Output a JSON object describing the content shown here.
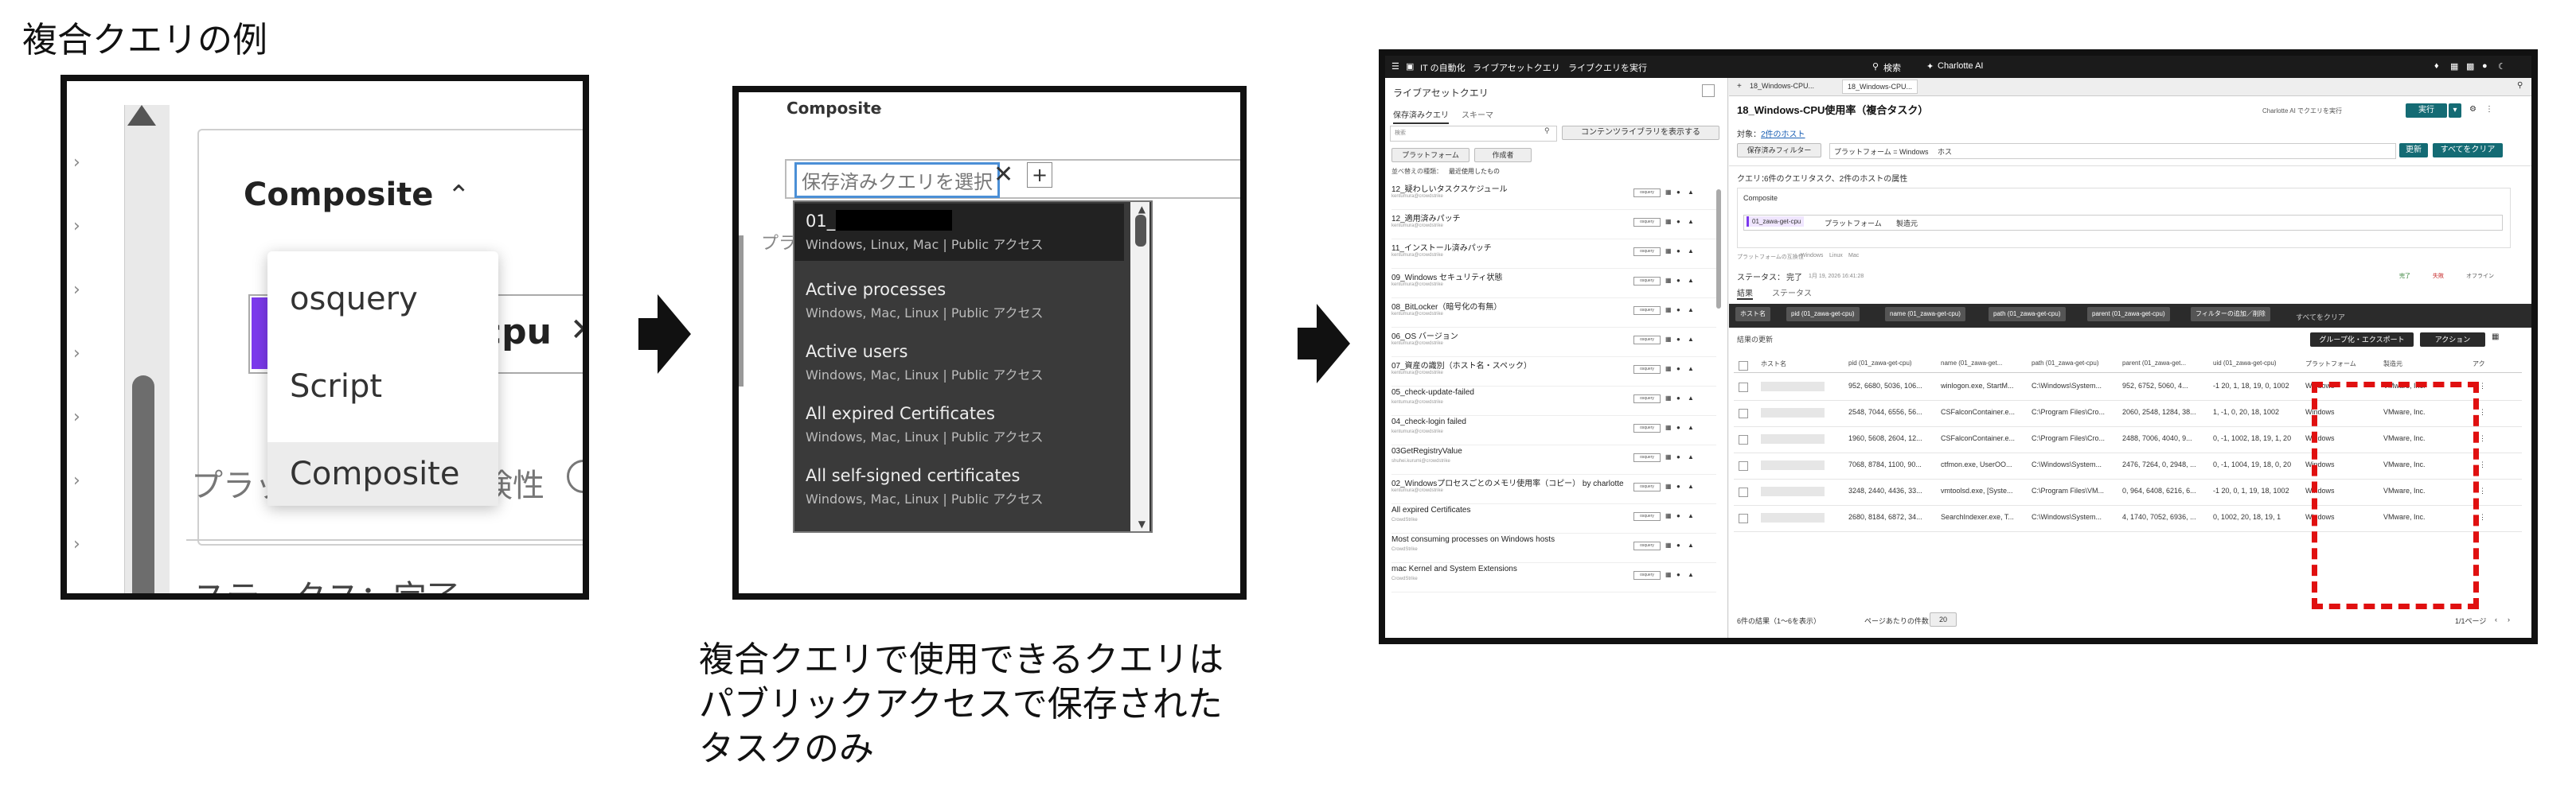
{
  "figure": {
    "title": "複合クエリの例",
    "caption_lines": [
      "複合クエリで使用できるクエリは",
      "パブリックアクセスで保存された",
      "タスクのみ"
    ]
  },
  "panel1": {
    "selector_label": "Composite",
    "menu_items": [
      "osquery",
      "Script",
      "Composite"
    ],
    "chip_text": "cpu",
    "platform_label": "プラッ",
    "search_label": "検性",
    "status_text": "ステータス：完了"
  },
  "panel2": {
    "selector_label": "Composite",
    "placeholder": "保存済みクエリを選択",
    "platform_label": "プラ",
    "items": [
      {
        "name": "01_",
        "sub": "Windows, Linux, Mac | Public アクセス"
      },
      {
        "name": "Active processes",
        "sub": "Windows, Mac, Linux | Public アクセス"
      },
      {
        "name": "Active users",
        "sub": "Windows, Mac, Linux | Public アクセス"
      },
      {
        "name": "All expired Certificates",
        "sub": "Windows, Mac, Linux | Public アクセス"
      },
      {
        "name": "All self-signed certificates",
        "sub": "Windows, Mac, Linux | Public アクセス"
      }
    ]
  },
  "panel3": {
    "topbar": {
      "menu": "IT の自動化",
      "crumb1": "ライブアセットクエリ",
      "crumb2": "ライブクエリを実行",
      "search": "検索",
      "brand": "Charlotte AI"
    },
    "left": {
      "title": "ライブアセットクエリ",
      "tabs": [
        "保存済みクエリ",
        "スキーマ"
      ],
      "search_placeholder": "検索",
      "content_library_btn": "コンテンツライブラリを表示する",
      "filters": [
        "プラットフォーム",
        "作成者"
      ],
      "sort_label": "並べ替えの種類：",
      "sort_value": "最近使用したもの",
      "rows": [
        {
          "name": "12_疑わしいタスクスケジュール",
          "author": "kentumura@crowdstrike"
        },
        {
          "name": "12_適用済みパッチ",
          "author": "kentumura@crowdstrike"
        },
        {
          "name": "11_インストール済みパッチ",
          "author": "kentumura@crowdstrike"
        },
        {
          "name": "09_Windows セキュリティ状態",
          "author": "kentumura@crowdstrike"
        },
        {
          "name": "08_BitLocker（暗号化の有無）",
          "author": "kentumura@crowdstrike"
        },
        {
          "name": "06_OS バージョン",
          "author": "kentumura@crowdstrike"
        },
        {
          "name": "07_資産の識別（ホスト名・スペック）",
          "author": "kentumura@crowdstrike"
        },
        {
          "name": "05_check-update-failed",
          "author": "kentumura@crowdstrike"
        },
        {
          "name": "04_check-login failed",
          "author": "kentumura@crowdstrike"
        },
        {
          "name": "03GetRegistryValue",
          "author": "shuhei.kurumi@crowdstrike"
        },
        {
          "name": "02_Windowsプロセスごとのメモリ使用率（コピー） by charlotte",
          "author": "kentumura@crowdstrike"
        },
        {
          "name": "All expired Certificates",
          "author": "CrowdStrike"
        },
        {
          "name": "Most consuming processes on Windows hosts",
          "author": "CrowdStrike"
        },
        {
          "name": "mac Kernel and System Extensions",
          "author": "CrowdStrike"
        }
      ],
      "row_tag": "osquery"
    },
    "right": {
      "tabs": [
        "18_Windows-CPU...",
        "18_Windows-CPU..."
      ],
      "heading": "18_Windows-CPU使用率（複合タスク）",
      "charlotte_btn": "Charlotte AI でクエリを実行",
      "run_btn": "実行",
      "target_label": "対象：",
      "target_value": "2件のホスト",
      "saved_filter": "保存済みフィルター",
      "filter_chip1": "プラットフォーム = Windows",
      "filter_chip2": "ホス",
      "refresh_btn": "更新",
      "clear_btn": "すべてをクリア",
      "query_label": "クエリ：",
      "query_desc": "6件のクエリタスク、2件のホストの属性",
      "composite_label": "Composite",
      "comp_chips": [
        "01_zawa-get-cpu",
        "プラットフォーム",
        "製造元"
      ],
      "platform_compat": "プラットフォームの互換性",
      "platforms": [
        "Windows",
        "Linux",
        "Mac"
      ],
      "status_label": "ステータス：",
      "status_value": "完了",
      "status_time": "1月 19, 2026 16:41:28",
      "legend": [
        "完了",
        "失敗",
        "オフライン"
      ],
      "result_tabs": [
        "結果",
        "ステータス"
      ],
      "col_chips": [
        "ホスト名",
        "pid (01_zawa-get-cpu)",
        "name (01_zawa-get-cpu)",
        "path (01_zawa-get-cpu)",
        "parent (01_zawa-get-cpu)",
        "フィルターの追加／削除"
      ],
      "clear_all": "すべてをクリア",
      "update_results": "結果の更新",
      "group_export": "グループ化・エクスポート",
      "action_btn": "アクション",
      "table_headers": [
        "ホスト名",
        "pid (01_zawa-get-cpu)",
        "name (01_zawa-get...",
        "path (01_zawa-get-cpu)",
        "parent (01_zawa-get...",
        "uid (01_zawa-get-cpu)",
        "プラットフォーム",
        "製造元",
        "アク"
      ],
      "rows": [
        [
          "",
          "952, 6680, 5036, 106...",
          "winlogon.exe, StartM...",
          "C:\\Windows\\System...",
          "952, 6752, 5060, 4...",
          "-1 20, 1, 18, 19, 0, 1002",
          "Windows",
          "VMware, Inc."
        ],
        [
          "",
          "2548, 7044, 6556, 56...",
          "CSFalconContainer.e...",
          "C:\\Program Files\\Cro...",
          "2060, 2548, 1284, 38...",
          "1, -1, 0, 20, 18, 1002",
          "Windows",
          "VMware, Inc."
        ],
        [
          "",
          "1960, 5608, 2604, 12...",
          "CSFalconContainer.e...",
          "C:\\Program Files\\Cro...",
          "2488, 7006, 4040, 9...",
          "0, -1, 1002, 18, 19, 1, 20",
          "Windows",
          "VMware, Inc."
        ],
        [
          "",
          "7068, 8784, 1100, 90...",
          "ctfmon.exe, UserOO...",
          "C:\\Windows\\System...",
          "2476, 7264, 0, 2948, ...",
          "0, -1, 1004, 19, 18, 0, 20",
          "Windows",
          "VMware, Inc."
        ],
        [
          "",
          "3248, 2440, 4436, 33...",
          "vmtoolsd.exe, [Syste...",
          "C:\\Program Files\\VM...",
          "0, 964, 6408, 6216, 6...",
          "-1 20, 0, 1, 19, 18, 1002",
          "Windows",
          "VMware, Inc."
        ],
        [
          "",
          "2680, 8184, 6872, 34...",
          "SearchIndexer.exe, T...",
          "C:\\Windows\\System...",
          "4, 1740, 7052, 6936, ...",
          "0, 1002, 20, 18, 19, 1",
          "Windows",
          "VMware, Inc."
        ]
      ],
      "footer_count": "6件の結果（1〜6を表示）",
      "per_page_label": "ページあたりの件数",
      "per_page": "20",
      "page_of": "1/1ページ"
    }
  }
}
